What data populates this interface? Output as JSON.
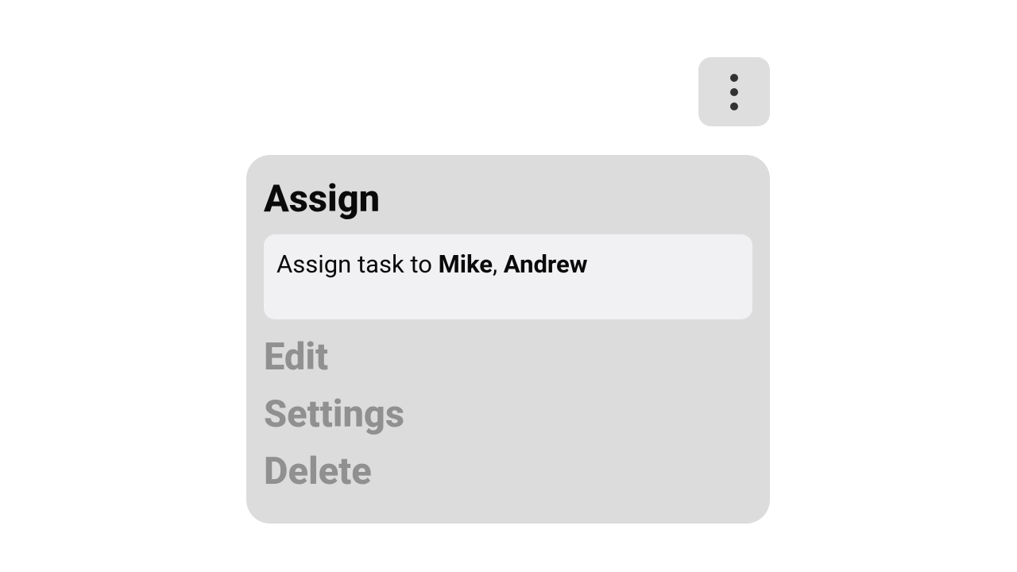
{
  "menu": {
    "items": [
      {
        "label": "Assign",
        "active": true
      },
      {
        "label": "Edit",
        "active": false
      },
      {
        "label": "Settings",
        "active": false
      },
      {
        "label": "Delete",
        "active": false
      }
    ]
  },
  "assign_panel": {
    "prefix": "Assign task to ",
    "names": [
      "Mike",
      "Andrew"
    ],
    "separator": ", "
  }
}
